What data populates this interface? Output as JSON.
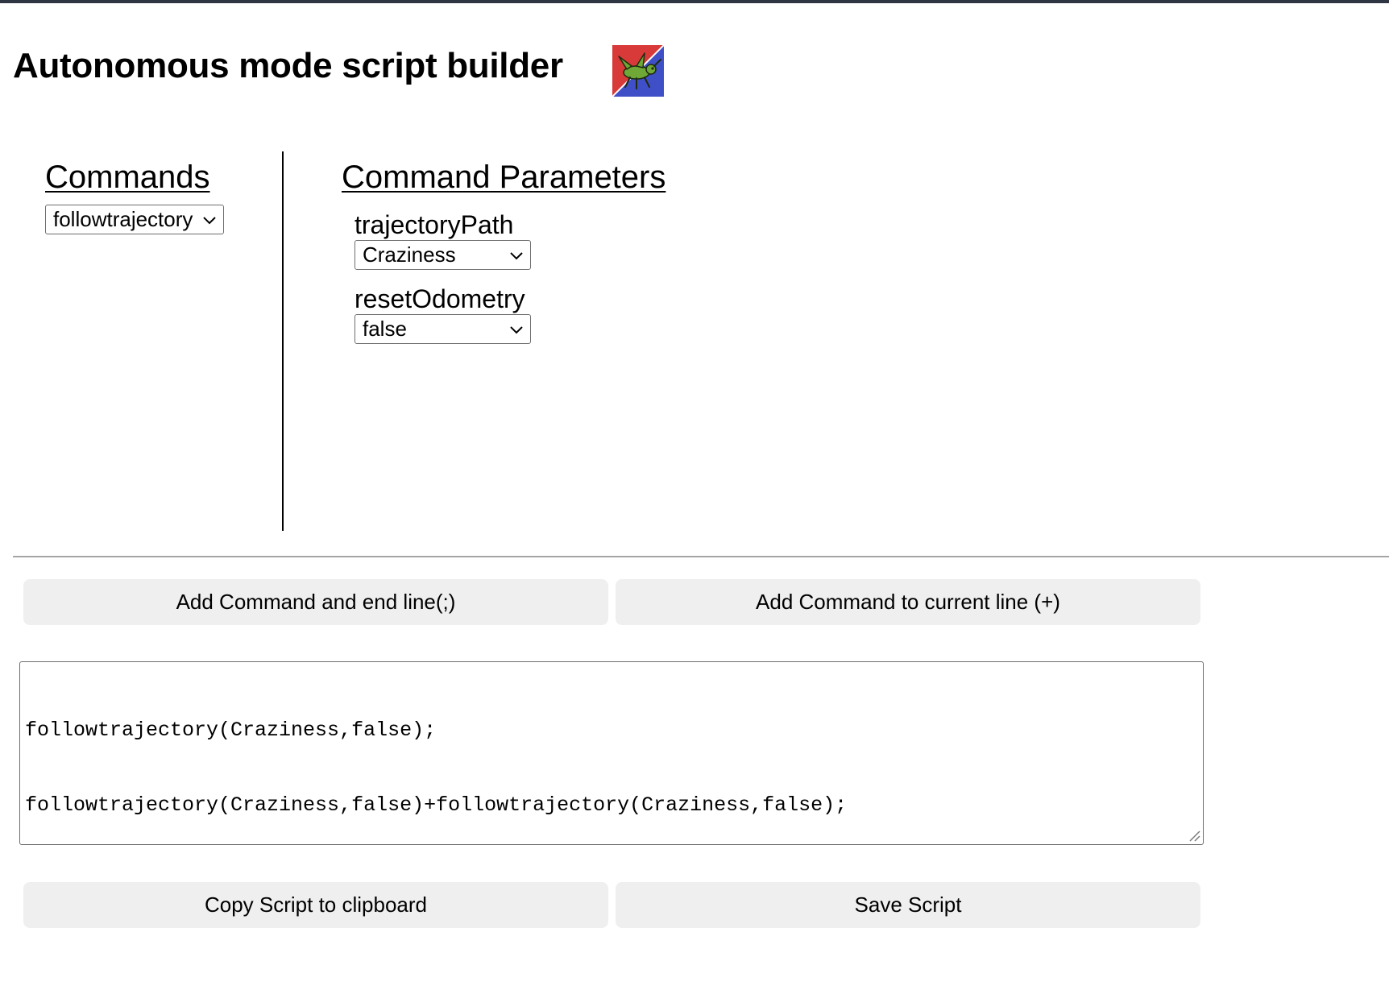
{
  "page": {
    "title": "Autonomous mode script builder",
    "logo_icon": "grasshopper-logo-icon"
  },
  "commands": {
    "heading": "Commands",
    "selected": "followtrajectory"
  },
  "parameters": {
    "heading": "Command Parameters",
    "items": [
      {
        "label": "trajectoryPath",
        "selected": "Craziness"
      },
      {
        "label": "resetOdometry",
        "selected": "false"
      }
    ]
  },
  "actions": {
    "add_end_line": "Add Command and end line(;)",
    "add_current_line": "Add Command to current line (+)",
    "copy_script": "Copy Script to clipboard",
    "save_script": "Save Script"
  },
  "script": {
    "lines": [
      "followtrajectory(Craziness,false);",
      "followtrajectory(Craziness,false)+followtrajectory(Craziness,false);"
    ]
  },
  "colors": {
    "logo_red": "#d83a3a",
    "logo_blue": "#3f4fc8",
    "logo_green": "#6fa836",
    "button_bg": "#efefef",
    "top_bar": "#2f3543"
  }
}
